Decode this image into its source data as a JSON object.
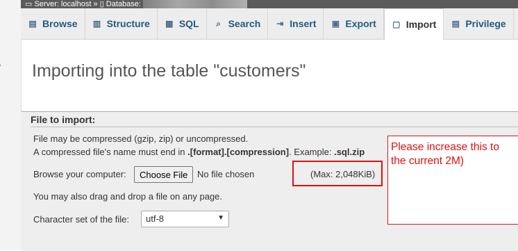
{
  "breadcrumb": {
    "server": "Server: localhost »",
    "database": "Database:"
  },
  "tabs": [
    {
      "label": "Browse",
      "icon": "browse-icon"
    },
    {
      "label": "Structure",
      "icon": "structure-icon"
    },
    {
      "label": "SQL",
      "icon": "sql-icon"
    },
    {
      "label": "Search",
      "icon": "search-icon"
    },
    {
      "label": "Insert",
      "icon": "insert-icon"
    },
    {
      "label": "Export",
      "icon": "export-icon"
    },
    {
      "label": "Import",
      "icon": "import-icon",
      "active": true
    },
    {
      "label": "Privilege",
      "icon": "privileges-icon"
    }
  ],
  "page": {
    "title": "Importing into the table \"customers\""
  },
  "import": {
    "legend": "File to import:",
    "compress_note": "File may be compressed (gzip, zip) or uncompressed.",
    "name_note_prefix": "A compressed file's name must end in ",
    "name_note_format": ".[format].[compression]",
    "name_note_mid": ". Example: ",
    "name_note_example": ".sql.zip",
    "browse_label": "Browse your computer:",
    "choose_button": "Choose File",
    "no_file": "No file chosen",
    "max_size": "(Max: 2,048KiB)",
    "drag_note": "You may also drag and drop a file on any page.",
    "charset_label": "Character set of the file:",
    "charset_value": "utf-8"
  },
  "annotation": {
    "note": "Please increase this to\nthe current 2M)",
    "color": "#e01010"
  }
}
